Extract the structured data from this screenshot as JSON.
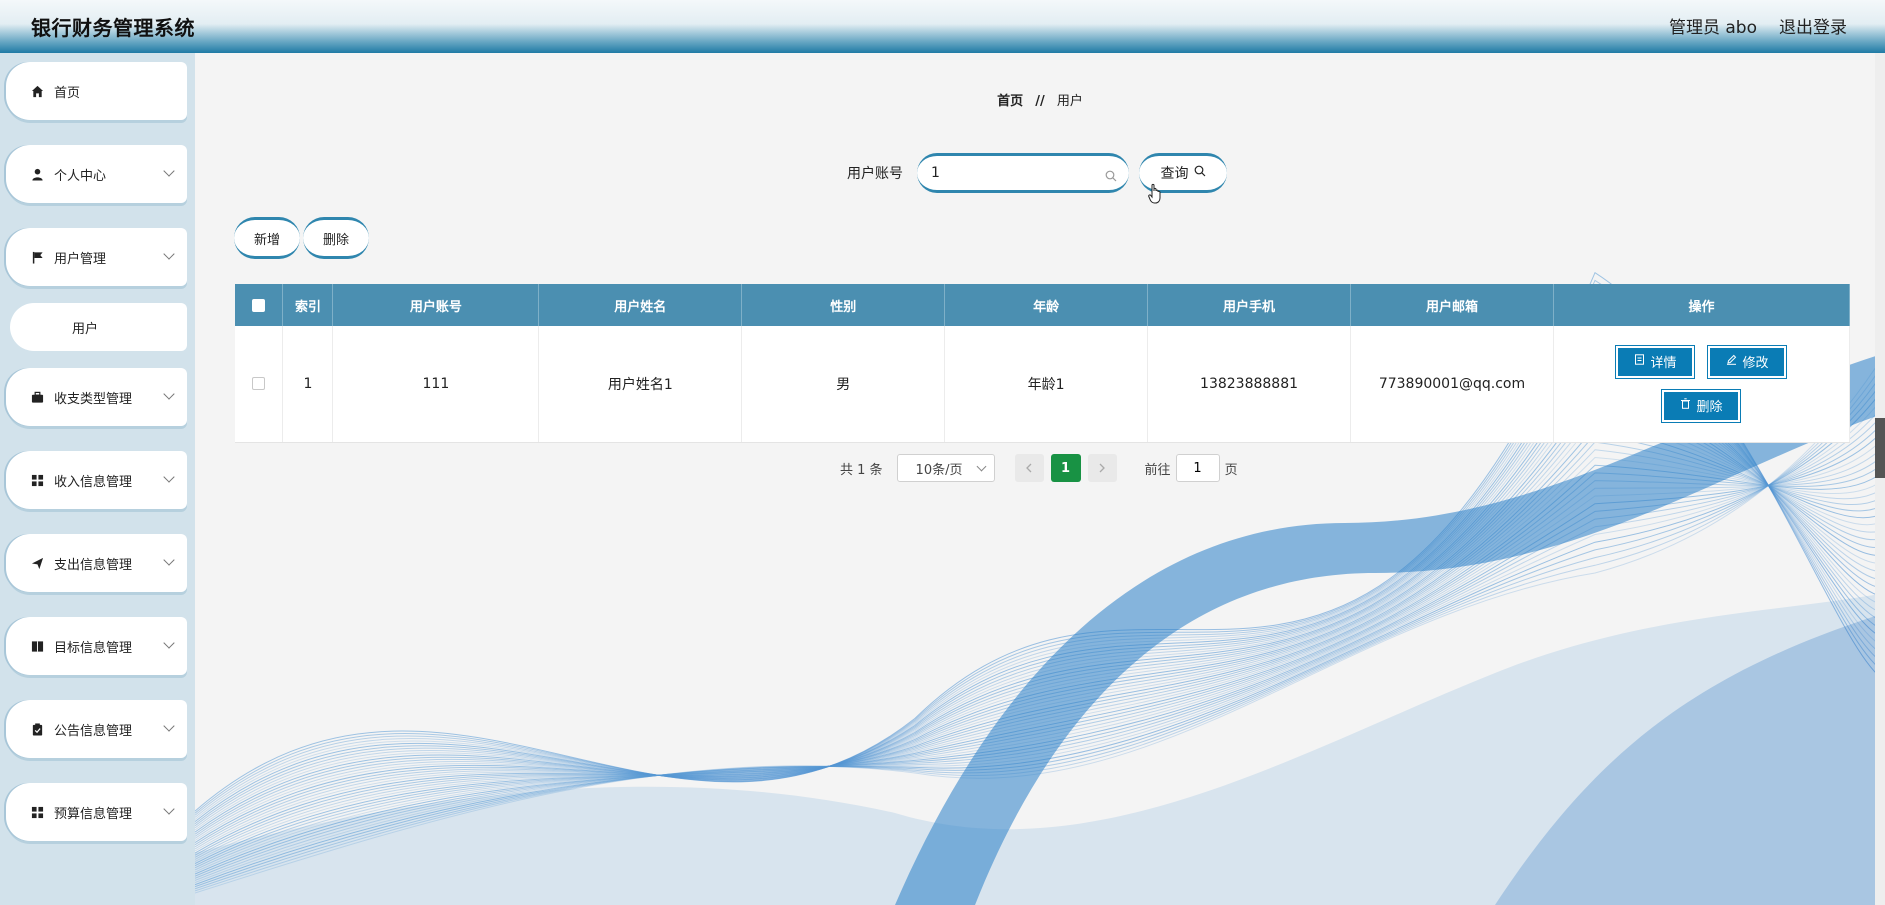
{
  "app": {
    "title": "银行财务管理系统",
    "user_label": "管理员 abo",
    "logout": "退出登录"
  },
  "sidebar": {
    "items": [
      {
        "label": "首页",
        "icon": "home-icon"
      },
      {
        "label": "个人中心",
        "icon": "user-icon"
      },
      {
        "label": "用户管理",
        "icon": "flag-icon"
      },
      {
        "label": "收支类型管理",
        "icon": "briefcase-icon"
      },
      {
        "label": "收入信息管理",
        "icon": "grid-icon"
      },
      {
        "label": "支出信息管理",
        "icon": "send-icon"
      },
      {
        "label": "目标信息管理",
        "icon": "book-icon"
      },
      {
        "label": "公告信息管理",
        "icon": "clipboard-icon"
      },
      {
        "label": "预算信息管理",
        "icon": "grid-icon"
      }
    ],
    "sub_item": "用户"
  },
  "breadcrumb": {
    "home": "首页",
    "separator": "//",
    "current": "用户"
  },
  "search": {
    "label": "用户账号",
    "value": "1",
    "button": "查询"
  },
  "actions": {
    "add": "新增",
    "delete": "删除"
  },
  "table": {
    "headers": [
      "索引",
      "用户账号",
      "用户姓名",
      "性别",
      "年龄",
      "用户手机",
      "用户邮箱",
      "操作"
    ],
    "rows": [
      {
        "index": "1",
        "account": "111",
        "name": "用户姓名1",
        "gender": "男",
        "age": "年龄1",
        "phone": "13823888881",
        "email": "773890001@qq.com"
      }
    ],
    "row_actions": {
      "detail": "详情",
      "edit": "修改",
      "delete": "删除"
    }
  },
  "pagination": {
    "total": "共 1 条",
    "page_size": "10条/页",
    "current_page": "1",
    "goto_label": "前往",
    "goto_value": "1",
    "page_unit": "页"
  },
  "colors": {
    "accent": "#0a7cb5",
    "header_bar": "#1f7aa5",
    "table_header": "#4b8fb1",
    "active_page": "#189244"
  }
}
